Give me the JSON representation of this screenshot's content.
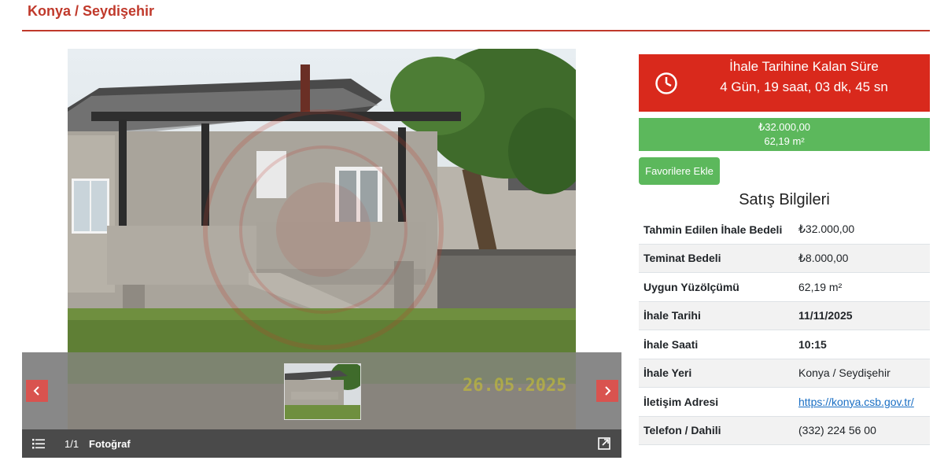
{
  "header": {
    "title": "Konya / Seydişehir"
  },
  "gallery": {
    "counter": "1/1",
    "label": "Fotoğraf",
    "date_stamp": "26.05.2025",
    "icons": {
      "prev": "chevron-left-icon",
      "next": "chevron-right-icon",
      "list": "list-icon",
      "expand": "expand-icon"
    }
  },
  "countdown": {
    "label": "İhale Tarihine Kalan Süre",
    "value": "4 Gün, 19 saat, 03 dk, 45 sn",
    "icon": "clock-icon",
    "color": "#d9291c"
  },
  "price": {
    "amount": "₺32.000,00",
    "area": "62,19 m²",
    "color": "#5cb85c"
  },
  "favorite_button": {
    "label": "Favorilere Ekle"
  },
  "sale_info": {
    "title": "Satış Bilgileri",
    "rows": [
      {
        "key": "Tahmin Edilen İhale Bedeli",
        "value": "₺32.000,00"
      },
      {
        "key": "Teminat Bedeli",
        "value": "₺8.000,00"
      },
      {
        "key": "Uygun Yüzölçümü",
        "value": "62,19 m²"
      },
      {
        "key": "İhale Tarihi",
        "value": "11/11/2025"
      },
      {
        "key": "İhale Saati",
        "value": "10:15"
      },
      {
        "key": "İhale Yeri",
        "value": "Konya / Seydişehir"
      },
      {
        "key": "İletişim Adresi",
        "value": "https://konya.csb.gov.tr/"
      },
      {
        "key": "Telefon / Dahili",
        "value": "(332) 224 56 00"
      }
    ]
  }
}
